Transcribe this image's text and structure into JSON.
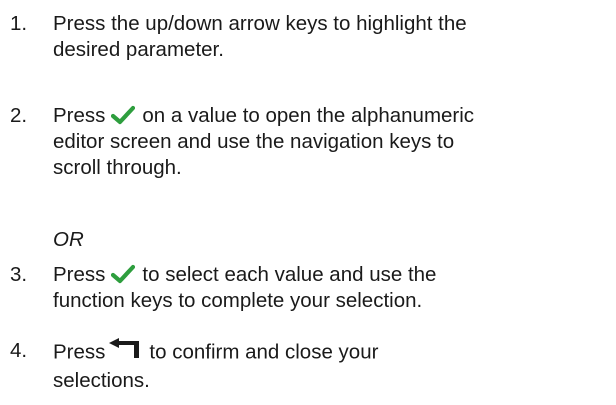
{
  "colors": {
    "check": "#2e9e3e",
    "arrow": "#1a1a1a",
    "text": "#1a1a1a"
  },
  "icons": {
    "select": "check-icon",
    "confirm": "enter-arrow-icon"
  },
  "steps": [
    {
      "number": "1.",
      "lines": [
        "Press the up/down arrow keys to highlight the",
        "desired parameter."
      ]
    },
    {
      "number": "2.",
      "lead": "Press",
      "first_line_rest": "on a value to open the alphanumeric",
      "lines": [
        "editor screen and use the navigation keys to",
        "scroll through."
      ]
    },
    {
      "number": "3.",
      "lead": "Press",
      "first_line_rest": "to select each value and use the",
      "lines": [
        "function keys to complete your selection."
      ]
    },
    {
      "number": "4.",
      "lead": "Press",
      "first_line_rest": "to confirm and close your",
      "lines": [
        "selections."
      ]
    }
  ],
  "or_label": "OR"
}
